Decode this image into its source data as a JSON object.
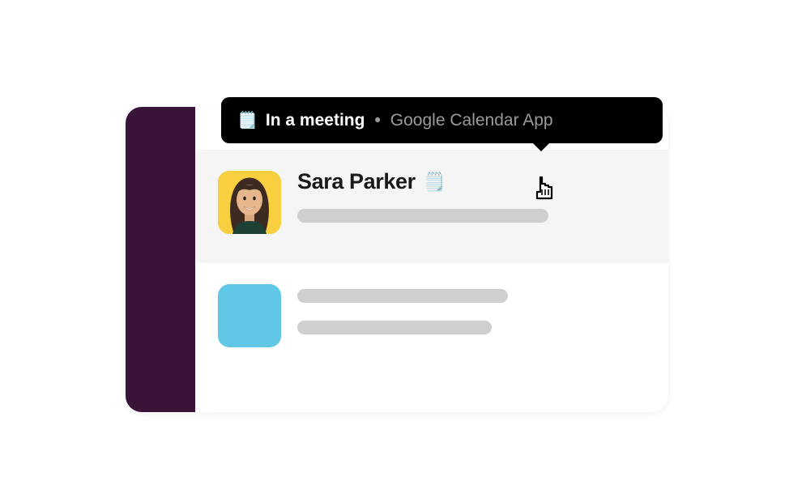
{
  "tooltip": {
    "emoji": "🗒️",
    "status": "In a meeting",
    "separator": "•",
    "source": "Google Calendar App"
  },
  "messages": [
    {
      "sender": "Sara Parker",
      "status_emoji": "🗒️"
    }
  ],
  "colors": {
    "sidebar": "#3a1339",
    "avatar_placeholder": "#60c7e6",
    "tooltip_bg": "#000000"
  }
}
